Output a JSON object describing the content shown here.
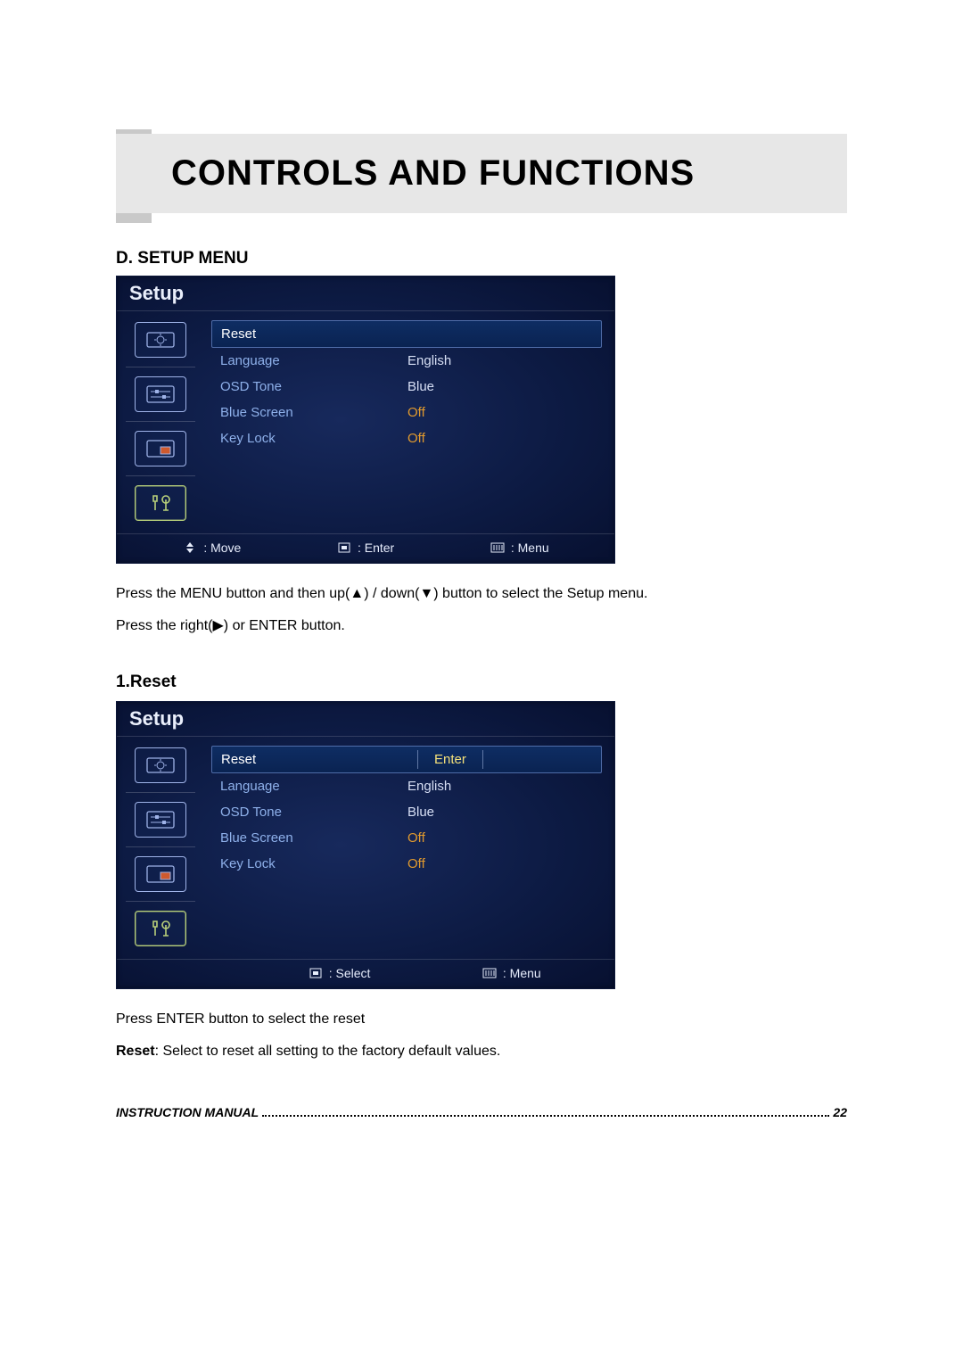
{
  "page": {
    "title": "CONTROLS AND FUNCTIONS",
    "section_heading": "D. SETUP MENU",
    "sub_heading": "1.Reset",
    "instruction_a": "Press the MENU button and then up(▲) / down(▼) button to select the Setup menu.",
    "instruction_b": "Press the right(▶) or ENTER button.",
    "instruction_c": "Press ENTER button to select the reset",
    "reset_bold": "Reset",
    "reset_desc": ": Select to reset all setting to the factory default values.",
    "footer_label": "INSTRUCTION MANUAL",
    "footer_page": "22"
  },
  "osd1": {
    "title": "Setup",
    "rows": [
      {
        "label": "Reset",
        "value": ""
      },
      {
        "label": "Language",
        "value": "English"
      },
      {
        "label": "OSD Tone",
        "value": "Blue"
      },
      {
        "label": "Blue Screen",
        "value": "Off"
      },
      {
        "label": "Key Lock",
        "value": "Off"
      }
    ],
    "hints": {
      "move": ": Move",
      "enter": ": Enter",
      "menu": ": Menu"
    }
  },
  "osd2": {
    "title": "Setup",
    "rows": [
      {
        "label": "Reset",
        "value": "Enter"
      },
      {
        "label": "Language",
        "value": "English"
      },
      {
        "label": "OSD Tone",
        "value": "Blue"
      },
      {
        "label": "Blue Screen",
        "value": "Off"
      },
      {
        "label": "Key Lock",
        "value": "Off"
      }
    ],
    "hints": {
      "select": ": Select",
      "menu": ": Menu"
    }
  },
  "icons": {
    "sidebar": [
      "eco-icon",
      "sliders-icon",
      "pip-icon",
      "tools-icon"
    ]
  }
}
